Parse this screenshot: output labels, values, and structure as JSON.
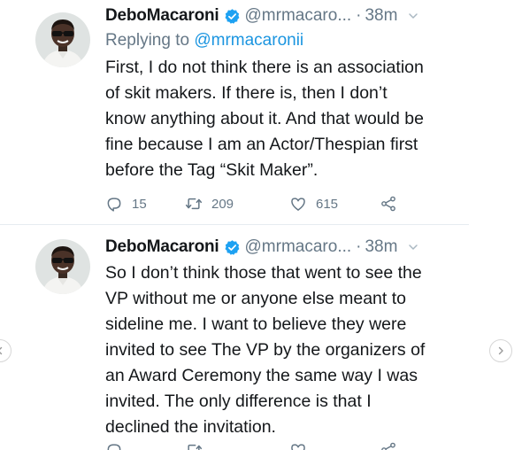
{
  "tweets": [
    {
      "name": "DeboMacaroni",
      "handle": "@mrmacaro...",
      "separator": "·",
      "time": "38m",
      "replying_prefix": "Replying to",
      "replying_handle": "@mrmacaronii",
      "lines": [
        "First, I do not think there is an association",
        "of skit makers. If there is, then I don’t",
        "know anything about it. And that would be",
        "fine because I am an Actor/Thespian first",
        "before the Tag “Skit Maker”."
      ],
      "replies": "15",
      "retweets": "209",
      "likes": "615"
    },
    {
      "name": "DeboMacaroni",
      "handle": "@mrmacaro...",
      "separator": "·",
      "time": "38m",
      "lines": [
        "So I don’t think those that went to see the",
        "VP without me or anyone else meant to",
        "sideline me. I want to believe they were",
        "invited to see The VP by the organizers of",
        "an Award Ceremony the same way I was",
        "invited. The only difference is that I",
        "declined the invitation."
      ]
    }
  ],
  "icons": {
    "verified": "verified-badge-icon",
    "chevron": "chevron-down-icon",
    "reply": "reply-icon",
    "retweet": "retweet-icon",
    "like": "heart-icon",
    "share": "share-icon",
    "prev": "chevron-left-icon",
    "next": "chevron-right-icon"
  },
  "colors": {
    "accent": "#1b95e0",
    "verified": "#1da1f2",
    "text": "#14171a",
    "secondary": "#657786"
  }
}
